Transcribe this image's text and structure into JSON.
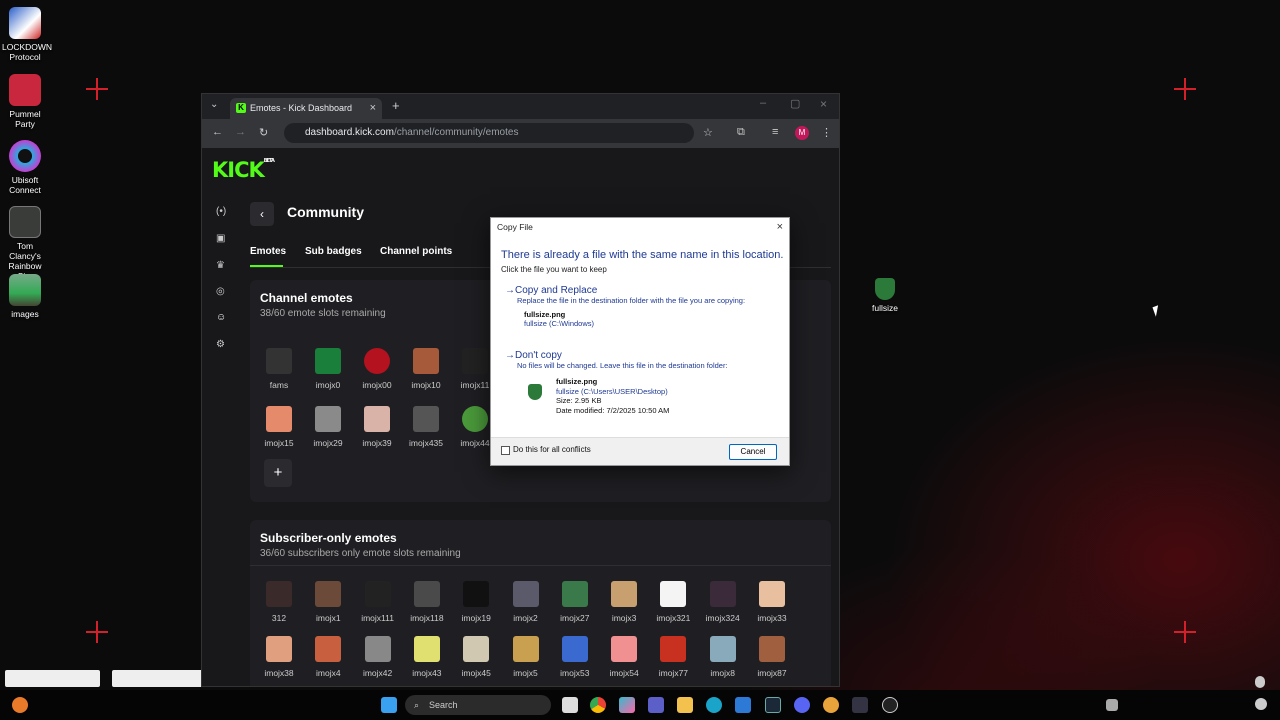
{
  "desktop": {
    "icons": [
      {
        "label": "LOCKDOWN Protocol"
      },
      {
        "label": "Pummel Party"
      },
      {
        "label": "Ubisoft Connect"
      },
      {
        "label": "Tom Clancy's Rainbow Si..."
      },
      {
        "label": "images"
      }
    ],
    "file_label": "fullsize"
  },
  "browser": {
    "tab_title": "Emotes - Kick Dashboard",
    "url_host": "dashboard.kick.com",
    "url_path": "/channel/community/emotes",
    "profile": "M"
  },
  "kick": {
    "logo": "KICK",
    "beta": "BETA",
    "page_title": "Community",
    "tabs": [
      "Emotes",
      "Sub badges",
      "Channel points"
    ],
    "channel": {
      "title": "Channel emotes",
      "sub": "38/60 emote slots remaining",
      "emotes": [
        "fams",
        "imojx0",
        "imojx00",
        "imojx10",
        "imojx11",
        "imojx15",
        "imojx29",
        "imojx39",
        "imojx435",
        "imojx44"
      ]
    },
    "subs": {
      "title": "Subscriber-only emotes",
      "sub": "36/60 subscribers only emote slots remaining",
      "emotes": [
        "312",
        "imojx1",
        "imojx111",
        "imojx118",
        "imojx19",
        "imojx2",
        "imojx27",
        "imojx3",
        "imojx321",
        "imojx324",
        "imojx33"
      ],
      "row2": [
        "imojx38",
        "imojx4",
        "imojx42",
        "imojx43",
        "imojx45",
        "imojx5",
        "imojx53",
        "imojx54",
        "imojx77",
        "imojx8",
        "imojx87"
      ]
    }
  },
  "dialog": {
    "title": "Copy File",
    "heading": "There is already a file with the same name in this location.",
    "sub": "Click the file you want to keep",
    "opt1_title": "Copy and Replace",
    "opt1_desc": "Replace the file in the destination folder with the file you are copying:",
    "opt1_file": "fullsize.png",
    "opt1_loc": "fullsize (C:\\Windows)",
    "opt2_title": "Don't copy",
    "opt2_desc": "No files will be changed. Leave this file in the destination folder:",
    "opt2_file": "fullsize.png",
    "opt2_loc": "fullsize (C:\\Users\\USER\\Desktop)",
    "opt2_size": "Size: 2.95 KB",
    "opt2_date": "Date modified: 7/2/2025 10:50 AM",
    "checkbox": "Do this for all conflicts",
    "cancel": "Cancel"
  },
  "taskbar": {
    "search": "Search"
  }
}
